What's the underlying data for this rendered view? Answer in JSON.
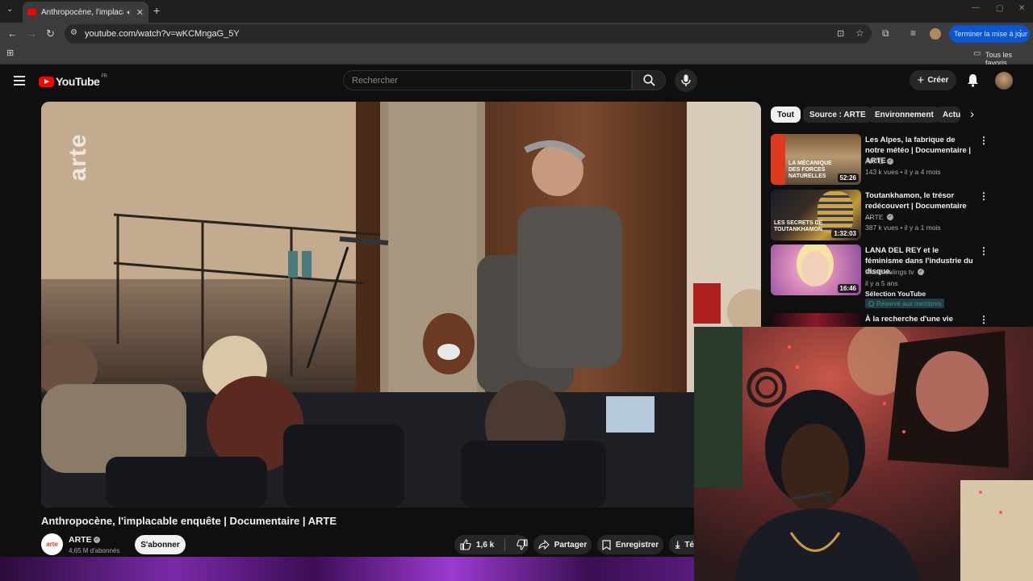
{
  "browser": {
    "tab_title": "Anthropocène, l'implacable",
    "url": "youtube.com/watch?v=wKCMngaG_5Y",
    "update_button": "Terminer la mise à jour",
    "bookmarks_label": "Tous les favoris"
  },
  "header": {
    "logo_text": "YouTube",
    "region": "FR",
    "search_placeholder": "Rechercher",
    "create_label": "Créer"
  },
  "video": {
    "watermark": "arte",
    "title": "Anthropocène, l'implacable enquête | Documentaire | ARTE",
    "channel_name": "ARTE",
    "channel_avatar_text": "arte",
    "subscribers": "4,65 M d'abonnés",
    "subscribe_label": "S'abonner",
    "likes": "1,6 k",
    "share_label": "Partager",
    "save_label": "Enregistrer",
    "download_label": "Té"
  },
  "chips": [
    "Tout",
    "Source : ARTE",
    "Environnement",
    "Actu"
  ],
  "recommendations": [
    {
      "title": "Les Alpes, la fabrique de notre météo | Documentaire | ARTE",
      "channel": "ARTE",
      "meta": "143 k vues • il y a 4 mois",
      "duration": "52:26",
      "thumb_text": "LA MÉCANIQUE DES FORCES NATURELLES"
    },
    {
      "title": "Toutankhamon, le trésor redécouvert | Documentaire ...",
      "channel": "ARTE",
      "meta": "387 k vues • il y a 1 mois",
      "duration": "1:32:03",
      "thumb_text": "LES SECRETS DE TOUTANKHAMON"
    },
    {
      "title": "LANA DEL REY et le féminisme dans l'industrie du disque.",
      "channel": "Musicfeelings tv",
      "meta": "il y a 5 ans",
      "duration": "16:46",
      "extra": "Sélection YouTube",
      "badge": "Réservé aux membres"
    },
    {
      "title": "À la recherche d'une vie",
      "channel": "",
      "meta": ""
    }
  ]
}
